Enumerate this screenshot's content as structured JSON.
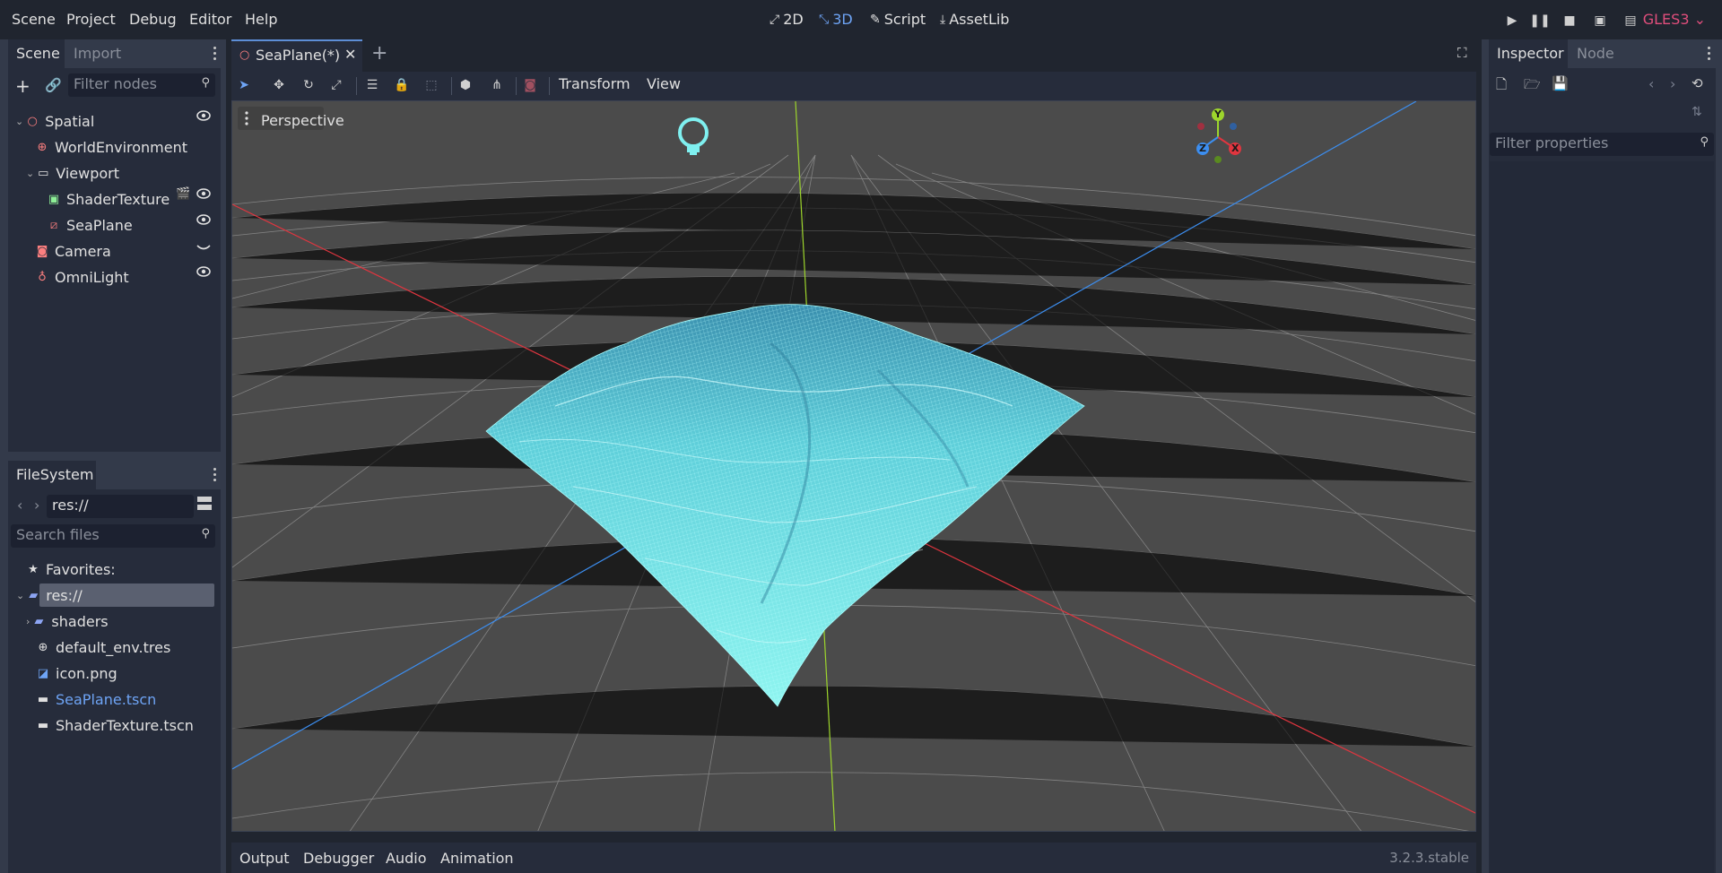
{
  "menu": [
    "Scene",
    "Project",
    "Debug",
    "Editor",
    "Help"
  ],
  "workspaces": {
    "two_d": "2D",
    "three_d": "3D",
    "script": "Script",
    "assetlib": "AssetLib"
  },
  "renderer": "GLES3",
  "scene_dock": {
    "tabs": [
      "Scene",
      "Import"
    ],
    "filter_placeholder": "Filter nodes",
    "nodes": [
      {
        "label": "Spatial",
        "icon": "spatial-icon"
      },
      {
        "label": "WorldEnvironment",
        "icon": "world-environment-icon"
      },
      {
        "label": "Viewport",
        "icon": "viewport-icon"
      },
      {
        "label": "ShaderTexture",
        "icon": "texture-rect-icon"
      },
      {
        "label": "SeaPlane",
        "icon": "mesh-instance-icon"
      },
      {
        "label": "Camera",
        "icon": "camera-icon"
      },
      {
        "label": "OmniLight",
        "icon": "omni-light-icon"
      }
    ]
  },
  "filesystem_dock": {
    "title": "FileSystem",
    "path": "res://",
    "search_placeholder": "Search files",
    "favorites": "Favorites:",
    "items": [
      {
        "label": "res://"
      },
      {
        "label": "shaders"
      },
      {
        "label": "default_env.tres"
      },
      {
        "label": "icon.png"
      },
      {
        "label": "SeaPlane.tscn"
      },
      {
        "label": "ShaderTexture.tscn"
      }
    ]
  },
  "editor": {
    "scene_tab": "SeaPlane(*)",
    "toolbar_menus": [
      "Transform",
      "View"
    ],
    "viewport_label": "Perspective",
    "gizmo_axes": [
      "Y",
      "Z",
      "X"
    ]
  },
  "bottom_panel": {
    "tabs": [
      "Output",
      "Debugger",
      "Audio",
      "Animation"
    ],
    "version": "3.2.3.stable"
  },
  "inspector_dock": {
    "tabs": [
      "Inspector",
      "Node"
    ],
    "filter_placeholder": "Filter properties"
  },
  "colors": {
    "accent": "#6ea4f5",
    "renderer": "#e14e7c",
    "x_axis": "#e0353f",
    "y_axis": "#9dd52c",
    "z_axis": "#3c8ef0",
    "water": "#7ff0f0"
  }
}
